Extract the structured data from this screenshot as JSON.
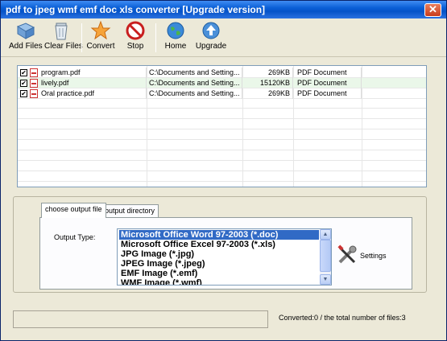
{
  "window": {
    "title": "pdf to jpeg wmf emf doc xls converter [Upgrade version]",
    "close_glyph": "✕"
  },
  "toolbar": {
    "buttons": [
      {
        "label": "Add Files",
        "icon": "add-files-icon"
      },
      {
        "label": "Clear Files",
        "icon": "trash-icon"
      },
      {
        "label": "Convert",
        "icon": "star-icon"
      },
      {
        "label": "Stop",
        "icon": "stop-icon"
      },
      {
        "label": "Home",
        "icon": "globe-icon"
      },
      {
        "label": "Upgrade",
        "icon": "upgrade-icon"
      }
    ]
  },
  "files": [
    {
      "checked": true,
      "name": "program.pdf",
      "path": "C:\\Documents and Setting...",
      "size": "269KB",
      "type": "PDF Document"
    },
    {
      "checked": true,
      "name": "lively.pdf",
      "path": "C:\\Documents and Setting...",
      "size": "15120KB",
      "type": "PDF Document"
    },
    {
      "checked": true,
      "name": "Oral practice.pdf",
      "path": "C:\\Documents and Setting...",
      "size": "269KB",
      "type": "PDF Document"
    }
  ],
  "tabs": [
    {
      "label": "choose output file",
      "active": true
    },
    {
      "label": "output directory",
      "active": false
    }
  ],
  "output": {
    "label": "Output Type:",
    "options": [
      "Microsoft Office Word 97-2003 (*.doc)",
      "Microsoft Office Excel 97-2003 (*.xls)",
      "JPG Image (*.jpg)",
      "JPEG Image (*.jpeg)",
      "EMF Image (*.emf)",
      "WMF Image (*.wmf)"
    ],
    "selected_index": 0
  },
  "settings": {
    "label": "Settings",
    "icon": "wrench-screwdriver-icon"
  },
  "status": {
    "text": "Converted:0  /  the total number of files:3"
  },
  "colors": {
    "titlebar": "#0a5fd6",
    "selection": "#316ac5",
    "alt_row": "#eaf7e9"
  }
}
